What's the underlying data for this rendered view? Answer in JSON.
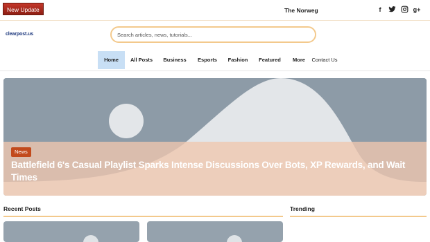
{
  "topbar": {
    "update_label": "New Update",
    "ticker_text": "The Norweg",
    "social": [
      {
        "icon": "facebook-icon",
        "glyph": "f"
      },
      {
        "icon": "twitter-icon",
        "glyph": ""
      },
      {
        "icon": "instagram-icon",
        "glyph": ""
      },
      {
        "icon": "google-plus-icon",
        "glyph": "g+"
      }
    ]
  },
  "header": {
    "logo_text": "clearpost.us",
    "search_placeholder": "Search articles, news, tutorials..."
  },
  "nav": {
    "items": [
      {
        "label": "Home",
        "active": true
      },
      {
        "label": "All Posts",
        "active": false
      },
      {
        "label": "Business",
        "active": false
      },
      {
        "label": "Esports",
        "active": false
      },
      {
        "label": "Fashion",
        "active": false
      },
      {
        "label": "Featured",
        "active": false
      },
      {
        "label": "More",
        "active": false
      },
      {
        "label": "Contact Us",
        "active": false
      }
    ]
  },
  "hero": {
    "tag": "News",
    "title": "Battlefield 6's Casual Playlist Sparks Intense Discussions Over Bots, XP Rewards, and Wait Times"
  },
  "sections": {
    "recent_title": "Recent Posts",
    "trending_title": "Trending"
  },
  "colors": {
    "accent": "#f3c98c",
    "badge": "#b02a1e",
    "nav_active": "#c8dff5",
    "tag": "#c24a1c",
    "logo": "#17337a"
  }
}
